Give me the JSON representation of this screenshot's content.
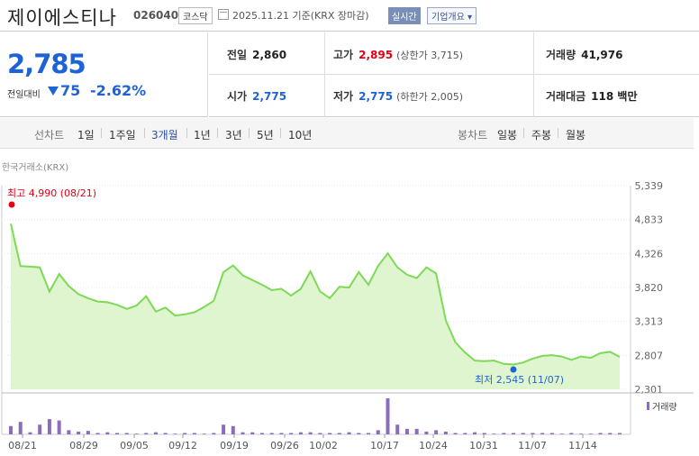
{
  "header": {
    "name": "제이에스티나",
    "code": "026040",
    "market": "코스닥",
    "date": "2025.11.21 기준(KRX 장마감)",
    "realtime": "실시간",
    "company_info": "기업개요 ▾"
  },
  "price": {
    "current": "2,785",
    "change_label": "전일대비",
    "change": "75",
    "change_pct": "-2.62%"
  },
  "stats": {
    "prev_close_label": "전일",
    "prev_close": "2,860",
    "high_label": "고가",
    "high": "2,895",
    "upper_limit": "(상한가 3,715)",
    "volume_label": "거래량",
    "volume": "41,976",
    "open_label": "시가",
    "open": "2,775",
    "low_label": "저가",
    "low": "2,775",
    "lower_limit": "(하한가 2,005)",
    "amount_label": "거래대금",
    "amount": "118 백만"
  },
  "line_tabs": {
    "label": "선차트",
    "items": [
      "1일",
      "1주일",
      "3개월",
      "1년",
      "3년",
      "5년",
      "10년"
    ],
    "selected": "3개월"
  },
  "candle_tabs": {
    "label": "봉차트",
    "items": [
      "일봉",
      "주봉",
      "월봉"
    ]
  },
  "source_label": "한국거래소(KRX)",
  "colors": {
    "up": "#e60012",
    "down": "#1e63d6",
    "line": "#7ed957",
    "fill": "#dff5cf",
    "volume": "#8a6dbf"
  },
  "chart_data": {
    "type": "area",
    "y_ticks": [
      5339,
      4833,
      4326,
      3820,
      3313,
      2807,
      2301
    ],
    "ylim": [
      2301,
      5339
    ],
    "x_ticks": [
      "08/21",
      "08/29",
      "09/05",
      "09/12",
      "09/19",
      "09/26",
      "10/02",
      "10/17",
      "10/24",
      "10/31",
      "11/07",
      "11/14"
    ],
    "max_label": "최고 4,990 (08/21)",
    "min_label": "최저 2,545 (11/07)",
    "volume_legend": "거래량",
    "series": [
      {
        "values": [
          4770,
          4140,
          4130,
          4120,
          3760,
          4020,
          3840,
          3720,
          3660,
          3610,
          3600,
          3560,
          3500,
          3550,
          3690,
          3460,
          3520,
          3400,
          3420,
          3450,
          3530,
          3620,
          4050,
          4150,
          4000,
          3930,
          3860,
          3780,
          3800,
          3700,
          3800,
          4060,
          3760,
          3660,
          3830,
          3820,
          4050,
          3860,
          4140,
          4330,
          4120,
          4010,
          3960,
          4120,
          4030,
          3330,
          3000,
          2850,
          2730,
          2720,
          2730,
          2680,
          2670,
          2700,
          2760,
          2800,
          2810,
          2790,
          2740,
          2790,
          2770,
          2840,
          2860,
          2785
        ]
      }
    ],
    "volume": [
      12,
      18,
      3,
      14,
      22,
      20,
      6,
      4,
      5,
      2,
      3,
      2,
      2,
      1,
      2,
      3,
      2,
      1,
      2,
      2,
      1,
      2,
      14,
      12,
      3,
      3,
      2,
      2,
      2,
      2,
      3,
      3,
      2,
      2,
      2,
      3,
      2,
      2,
      6,
      52,
      14,
      8,
      8,
      4,
      6,
      4,
      2,
      2,
      3,
      2,
      1,
      2,
      2,
      2,
      2,
      2,
      2,
      1,
      2,
      1,
      1,
      2,
      2,
      2
    ]
  }
}
